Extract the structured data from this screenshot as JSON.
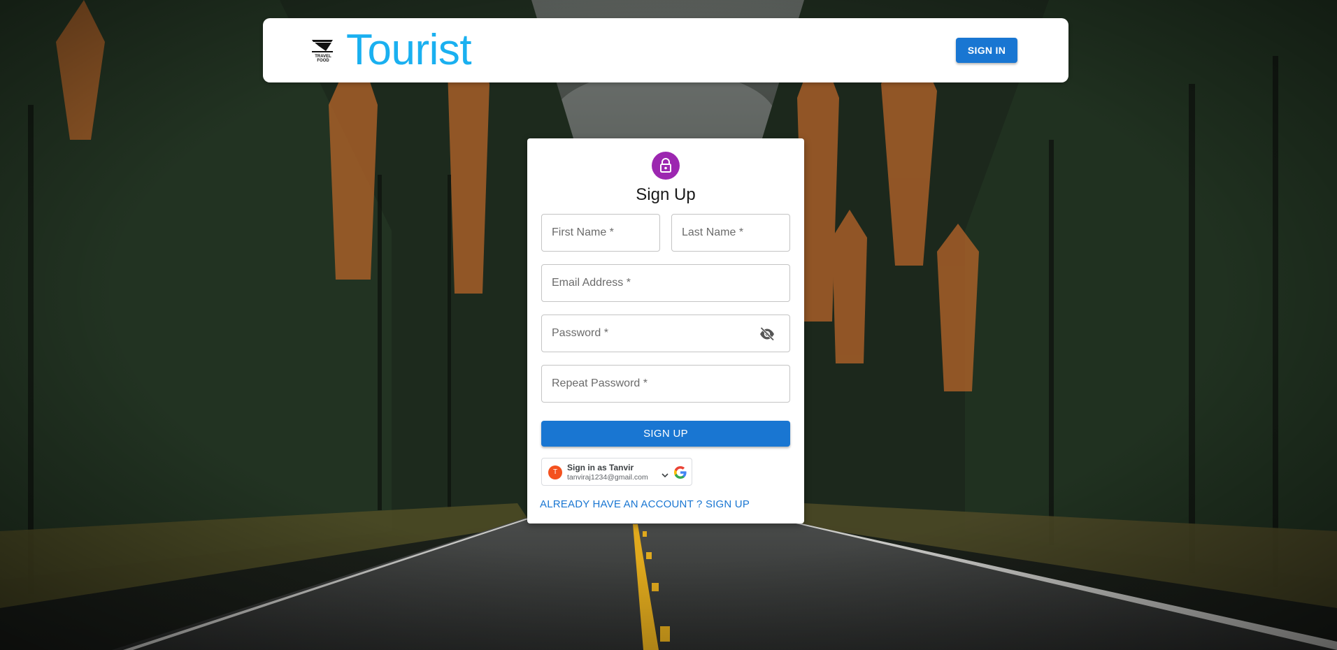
{
  "header": {
    "logo_text_line1": "TRAVEL",
    "logo_text_line2": "FOOD",
    "brand": "Tourist",
    "signin_label": "SIGN IN"
  },
  "form": {
    "title": "Sign Up",
    "first_name_placeholder": "First Name *",
    "last_name_placeholder": "Last Name *",
    "email_placeholder": "Email Address *",
    "password_placeholder": "Password *",
    "repeat_password_placeholder": "Repeat Password *",
    "signup_label": "SIGN UP",
    "account_link": "ALREADY HAVE AN ACCOUNT ? SIGN UP"
  },
  "google_signin": {
    "avatar_initial": "T",
    "name": "Sign in as Tanvir",
    "email": "tanviraj1234@gmail.com"
  },
  "icons": {
    "avatar": "lock-icon",
    "password_toggle": "visibility-off-icon",
    "google": "google-g-icon",
    "chevron": "chevron-down-icon"
  },
  "colors": {
    "brand": "#1ab0f0",
    "primary": "#1976d2",
    "avatar": "#9c27b0",
    "google_avatar": "#f4511e"
  }
}
